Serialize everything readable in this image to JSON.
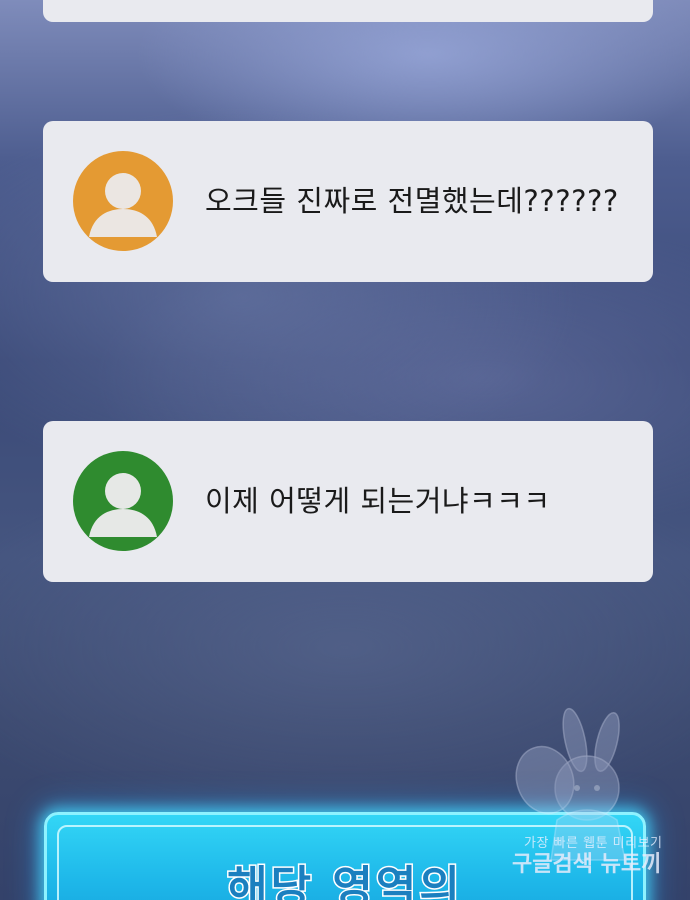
{
  "comments": [
    {
      "avatar_color": "#e49a33",
      "avatar_icon": "user-avatar-icon",
      "text": "오크들 진짜로 전멸했는데??????"
    },
    {
      "avatar_color": "#2f8b2f",
      "avatar_icon": "user-avatar-icon",
      "text": "이제 어떻게 되는거냐ㅋㅋㅋ"
    }
  ],
  "banner": {
    "text": "해당 영역의"
  },
  "watermark": {
    "line1": "가장 빠른 웹툰 미리보기",
    "line2": "구글검색 뉴토끼"
  }
}
